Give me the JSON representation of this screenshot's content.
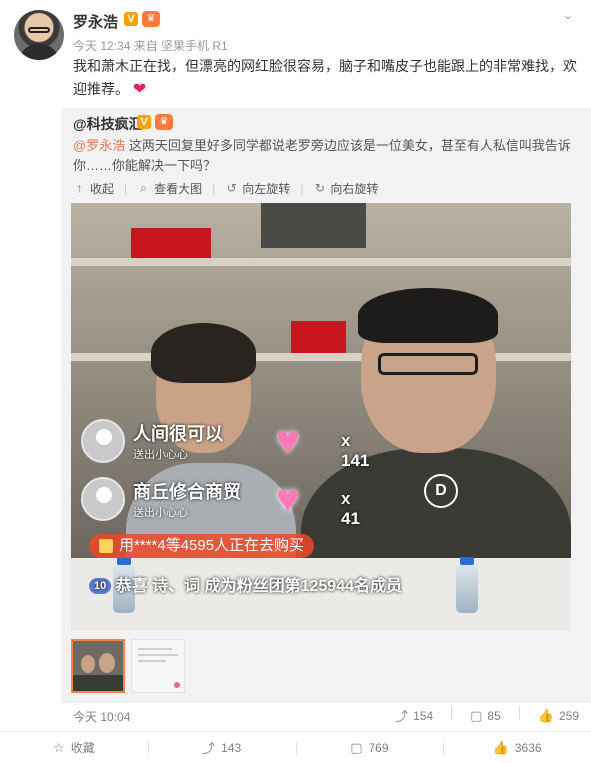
{
  "post": {
    "author": "罗永浩",
    "verified_badge": "V",
    "member_badge": "♛",
    "meta": "今天 12:34 来自 坚果手机 R1",
    "text": "我和萧木正在找，但漂亮的网红脸很容易，脑子和嘴皮子也能跟上的非常难找，欢迎推荐。",
    "emoji": "❤"
  },
  "repost": {
    "author": "@科技疯汇",
    "verified_badge": "V",
    "member_badge": "♛",
    "mention": "@罗永浩",
    "text": " 这两天回复里好多同学都说老罗旁边应该是一位美女，甚至有人私信叫我告诉你……你能解决一下吗？",
    "tools": {
      "collapse": "收起",
      "view_large": "查看大图",
      "rotate_left": "向左旋转",
      "rotate_right": "向右旋转"
    },
    "image": {
      "overlay_rows": [
        {
          "name": "人间很可以",
          "sub": "送出小心心",
          "count": "x 141"
        },
        {
          "name": "商丘修合商贸",
          "sub": "送出小心心",
          "count": "x 41"
        }
      ],
      "buy_bar": "用****4等4595人正在去购买",
      "fans_badge": "10",
      "fans_line": "恭喜 诗、词 成为粉丝团第125944名成员",
      "logo_text": "D"
    },
    "footer": {
      "time": "今天 10:04",
      "repost_count": "154",
      "comment_count": "85",
      "like_count": "259"
    }
  },
  "bottom_bar": {
    "favorite": "收藏",
    "repost": "143",
    "comment": "769",
    "like": "3636"
  },
  "colors": {
    "accent": "#eb7350",
    "verified": "#f7a200",
    "repost_bg": "#f2f2f5"
  }
}
